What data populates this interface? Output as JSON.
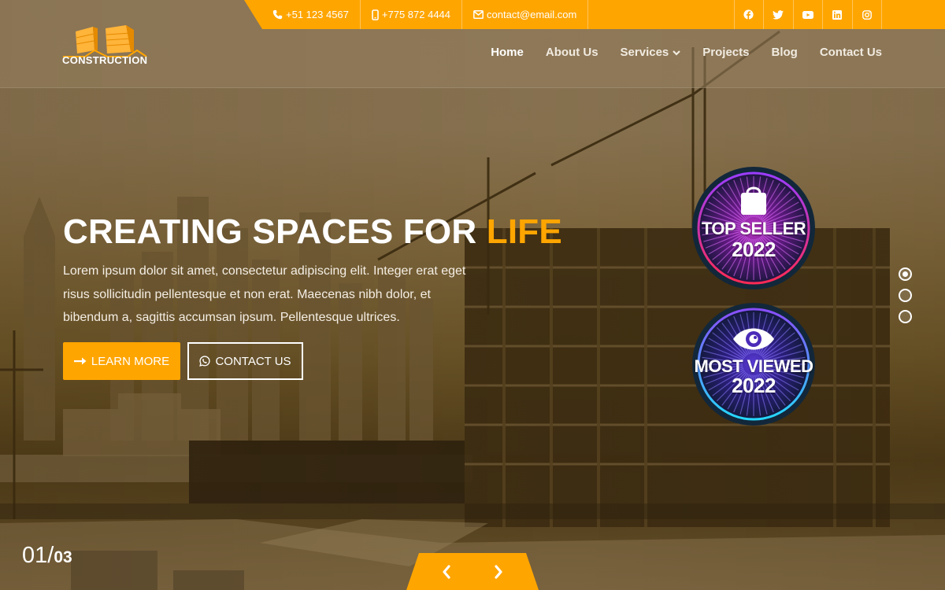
{
  "brand": {
    "logo_text": "CONSTRUCTION",
    "accent_color": "#ffa500"
  },
  "topbar": {
    "contacts": [
      {
        "icon": "phone-icon",
        "text": "+51 123 4567"
      },
      {
        "icon": "mobile-icon",
        "text": "+775 872 4444"
      },
      {
        "icon": "envelope-icon",
        "text": "contact@email.com"
      }
    ],
    "socials": [
      "facebook-icon",
      "twitter-icon",
      "youtube-icon",
      "linkedin-icon",
      "instagram-icon"
    ]
  },
  "nav": {
    "items": [
      {
        "label": "Home",
        "active": true
      },
      {
        "label": "About Us"
      },
      {
        "label": "Services",
        "dropdown": true
      },
      {
        "label": "Projects"
      },
      {
        "label": "Blog"
      },
      {
        "label": "Contact Us"
      }
    ]
  },
  "hero": {
    "title_main": "CREATING SPACES FOR ",
    "title_accent": "LIFE",
    "text": "Lorem ipsum dolor sit amet, consectetur adipiscing elit. Integer erat eget risus sollicitudin pellentesque et non erat. Maecenas nibh dolor, et bibendum a, sagittis accumsan ipsum. Pellentesque ultrices.",
    "primary_button": "LEARN MORE",
    "secondary_button": "CONTACT US"
  },
  "badges": [
    {
      "title": "TOP SELLER",
      "year": "2022",
      "icon": "shopping-bag-icon"
    },
    {
      "title": "MOST VIEWED",
      "year": "2022",
      "icon": "eye-icon"
    }
  ],
  "slider": {
    "current": "01",
    "separator": "/",
    "total": "03",
    "dots": 3,
    "active_dot": 1
  }
}
